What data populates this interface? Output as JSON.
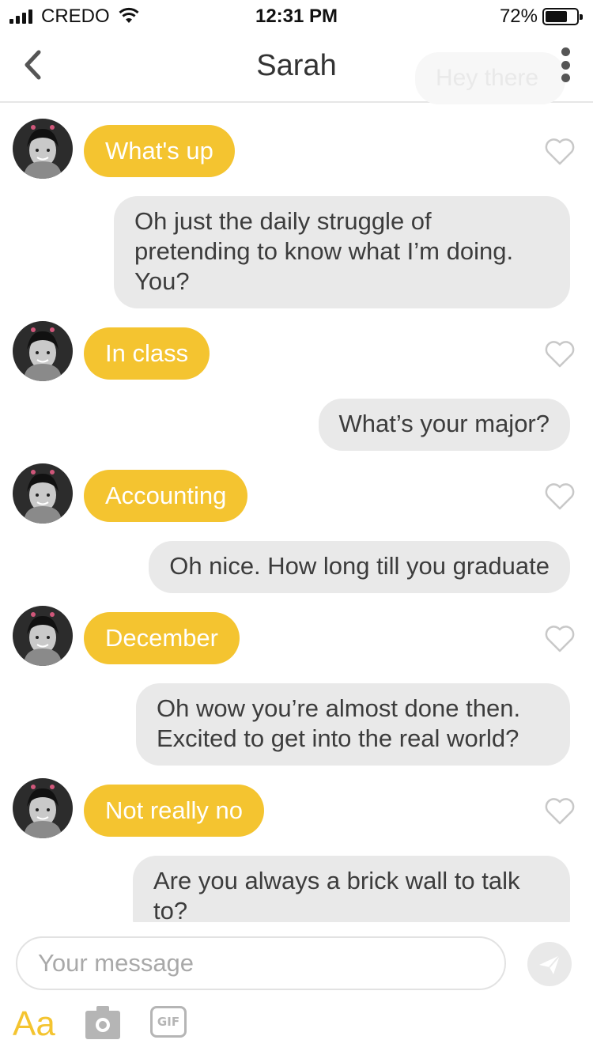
{
  "status_bar": {
    "carrier": "CREDO",
    "time": "12:31 PM",
    "battery": "72%",
    "battery_level": 0.72
  },
  "header": {
    "title": "Sarah",
    "ghost_preview": "Hey there"
  },
  "messages": [
    {
      "from": "them",
      "text": "What's up"
    },
    {
      "from": "me",
      "text": "Oh just the daily struggle of pretending to know what I’m doing. You?"
    },
    {
      "from": "them",
      "text": "In class"
    },
    {
      "from": "me",
      "text": "What’s your major?"
    },
    {
      "from": "them",
      "text": "Accounting"
    },
    {
      "from": "me",
      "text": "Oh nice. How long till you graduate"
    },
    {
      "from": "them",
      "text": "December"
    },
    {
      "from": "me",
      "text": "Oh wow you’re almost done then. Excited to get into the real world?"
    },
    {
      "from": "them",
      "text": "Not really no"
    },
    {
      "from": "me",
      "text": "Are you always a brick wall to talk to?"
    }
  ],
  "composer": {
    "placeholder": "Your message",
    "font_label": "Aa",
    "gif_label": "GIF"
  },
  "colors": {
    "accent": "#f4c430",
    "outgoing_bubble": "#e9e9e9"
  },
  "icons": [
    "signal-icon",
    "wifi-icon",
    "battery-icon",
    "back-icon",
    "more-icon",
    "avatar",
    "heart-icon",
    "send-icon",
    "camera-icon",
    "gif-icon"
  ]
}
